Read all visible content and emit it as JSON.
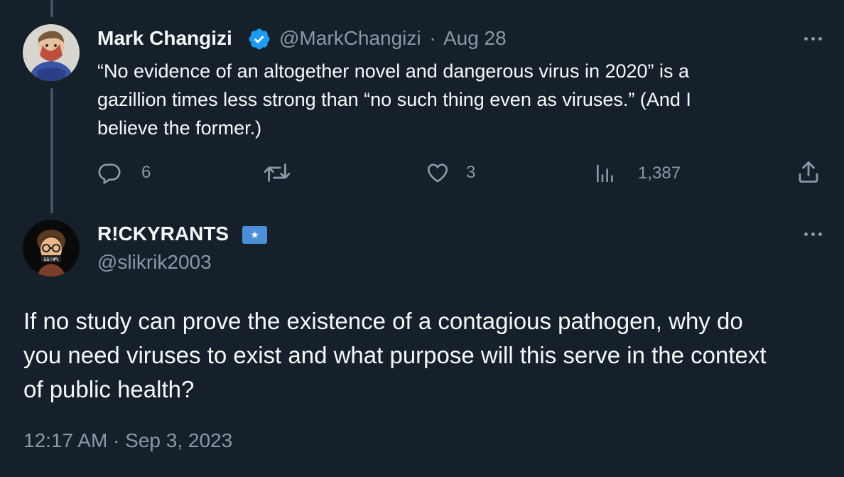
{
  "parent_tweet": {
    "author_name": "Mark Changizi",
    "handle": "@MarkChangizi",
    "separator": "·",
    "date": "Aug 28",
    "text_lines": [
      "“No evidence of an altogether novel and dangerous virus in 2020” is a",
      "gazillion times less strong than “no such thing even as viruses.” (And I",
      "believe the former.)"
    ],
    "actions": {
      "replies": "6",
      "retweets": "",
      "likes": "3",
      "views": "1,387"
    }
  },
  "main_tweet": {
    "author_name": "R!CKYRANTS",
    "handle": "@slikrik2003",
    "text_lines": [
      "If no study can prove the existence of a contagious pathogen, why do",
      "you need viruses to exist and what purpose will this serve in the context",
      "of public health?"
    ],
    "timestamp": "12:17 AM · Sep 3, 2023"
  },
  "colors": {
    "background": "#15202b",
    "text_primary": "#f7f9f9",
    "text_secondary": "#8b98a5",
    "verified_blue": "#1d9bf0",
    "thread_line": "#425364"
  },
  "icons": {
    "verified": "verified-badge-icon",
    "reply": "reply-icon",
    "retweet": "retweet-icon",
    "like": "heart-icon",
    "views": "views-icon",
    "share": "share-icon",
    "more": "more-icon",
    "badge": "star-badge-icon"
  }
}
